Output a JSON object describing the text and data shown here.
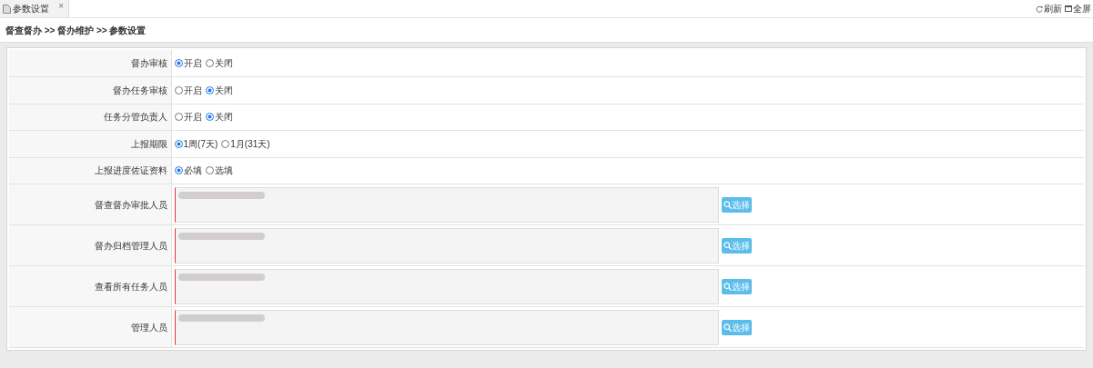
{
  "tab": {
    "title": "参数设置",
    "close": "×"
  },
  "toolbar": [
    {
      "kind": "refresh",
      "label": "刷新"
    },
    {
      "kind": "fullscreen",
      "label": "全屏"
    }
  ],
  "breadcrumb": "督查督办 >> 督办维护 >> 参数设置",
  "settings": [
    {
      "kind": "radio",
      "label": "督办审核",
      "options": [
        {
          "label": "开启",
          "selected": true
        },
        {
          "label": "关闭",
          "selected": false
        }
      ]
    },
    {
      "kind": "radio",
      "label": "督办任务审核",
      "options": [
        {
          "label": "开启",
          "selected": false
        },
        {
          "label": "关闭",
          "selected": true
        }
      ]
    },
    {
      "kind": "radio",
      "label": "任务分管负责人",
      "options": [
        {
          "label": "开启",
          "selected": false
        },
        {
          "label": "关闭",
          "selected": true
        }
      ]
    },
    {
      "kind": "radio",
      "label": "上报期限",
      "options": [
        {
          "label": "1周(7天)",
          "selected": true
        },
        {
          "label": "1月(31天)",
          "selected": false
        }
      ]
    },
    {
      "kind": "radio",
      "label": "上报进度佐证资料",
      "options": [
        {
          "label": "必填",
          "selected": true
        },
        {
          "label": "选填",
          "selected": false
        }
      ]
    },
    {
      "kind": "people",
      "label": "督查督办审批人员",
      "button": "选择"
    },
    {
      "kind": "people",
      "label": "督办归档管理人员",
      "button": "选择"
    },
    {
      "kind": "people",
      "label": "查看所有任务人员",
      "button": "选择"
    },
    {
      "kind": "people",
      "label": "管理人员",
      "button": "选择"
    }
  ]
}
